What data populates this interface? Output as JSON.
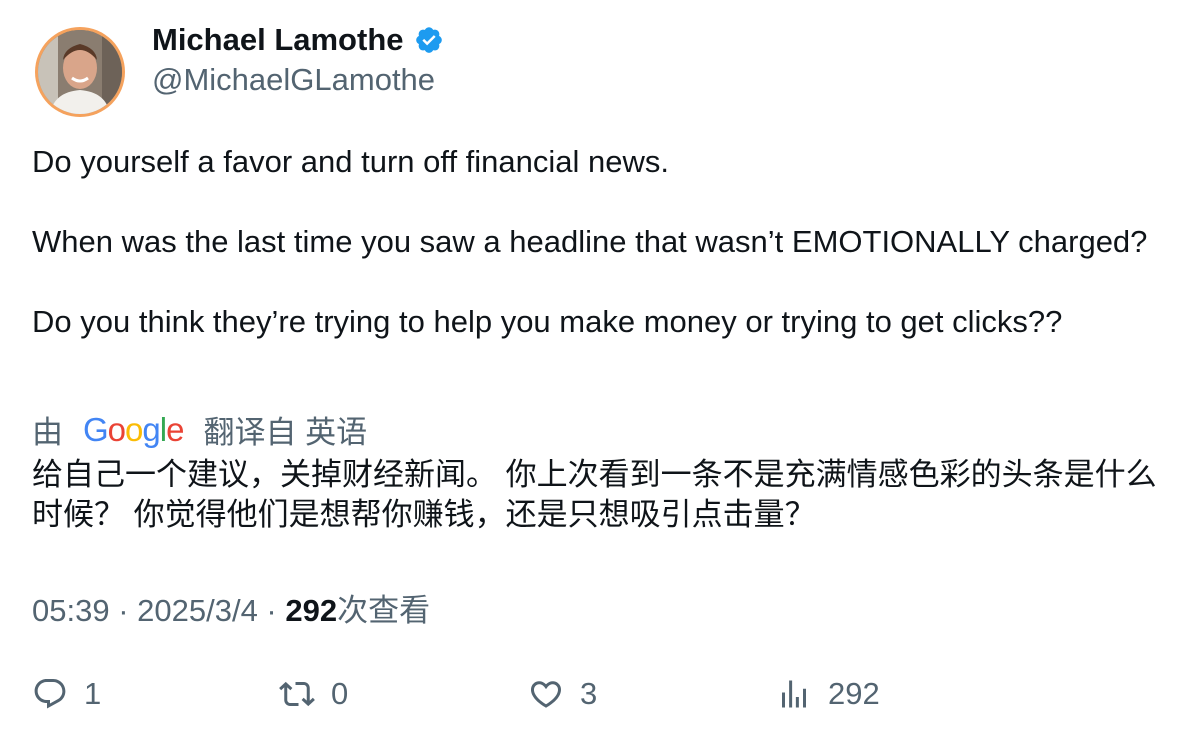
{
  "author": {
    "name": "Michael Lamothe",
    "handle": "@MichaelGLamothe",
    "verified": true
  },
  "tweet": {
    "paragraphs": [
      "Do yourself a favor and turn off financial news.",
      "When was the last time you saw a headline that wasn’t EMOTIONALLY charged?",
      "Do you think they’re trying to help you make money or trying to get clicks??"
    ]
  },
  "translation": {
    "prefix": "由",
    "provider": "Google",
    "suffix": "翻译自 英语",
    "text": "给自己一个建议，关掉财经新闻。 你上次看到一条不是充满情感色彩的头条是什么时候？ 你觉得他们是想帮你赚钱，还是只想吸引点击量？"
  },
  "meta": {
    "time": "05:39",
    "separator": " · ",
    "date": "2025/3/4",
    "views_count": "292",
    "views_label": "次查看"
  },
  "actions": {
    "replies": "1",
    "retweets": "0",
    "likes": "3",
    "views": "292"
  },
  "colors": {
    "text": "#0f1419",
    "secondary": "#536471",
    "verified": "#1d9bf0",
    "avatar_ring": "#f5a25d"
  },
  "icons": [
    "verified-badge-icon",
    "reply-icon",
    "retweet-icon",
    "like-icon",
    "views-icon"
  ]
}
